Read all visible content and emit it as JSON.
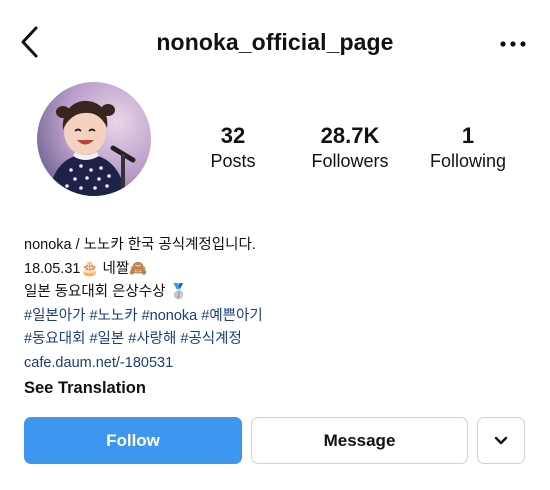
{
  "header": {
    "username": "nonoka_official_page"
  },
  "stats": [
    {
      "value": "32",
      "label": "Posts"
    },
    {
      "value": "28.7K",
      "label": "Followers"
    },
    {
      "value": "1",
      "label": "Following"
    }
  ],
  "bio": {
    "line1": "nonoka / 노노카 한국 공식계정입니다.",
    "line2_text": "18.05.31",
    "line2_emoji1": "🎂",
    "line2_text2": " 네짤",
    "line2_emoji2": "🙈",
    "line3_text": "일본 동요대회 은상수상 ",
    "line3_emoji": "🥈",
    "hashtags_row1": [
      "#일본아가",
      "#노노카",
      "#nonoka",
      "#예쁜아기"
    ],
    "hashtags_row2": [
      "#동요대회",
      "#일본",
      "#사랑해",
      "#공식계정"
    ],
    "link": "cafe.daum.net/-180531",
    "see_translation": "See Translation"
  },
  "actions": {
    "follow_label": "Follow",
    "message_label": "Message"
  },
  "colors": {
    "follow_button": "#3d97f0",
    "hashtag": "#1c3f7c"
  },
  "icons": [
    "back-arrow-icon",
    "more-dots-icon",
    "chevron-down-icon"
  ]
}
